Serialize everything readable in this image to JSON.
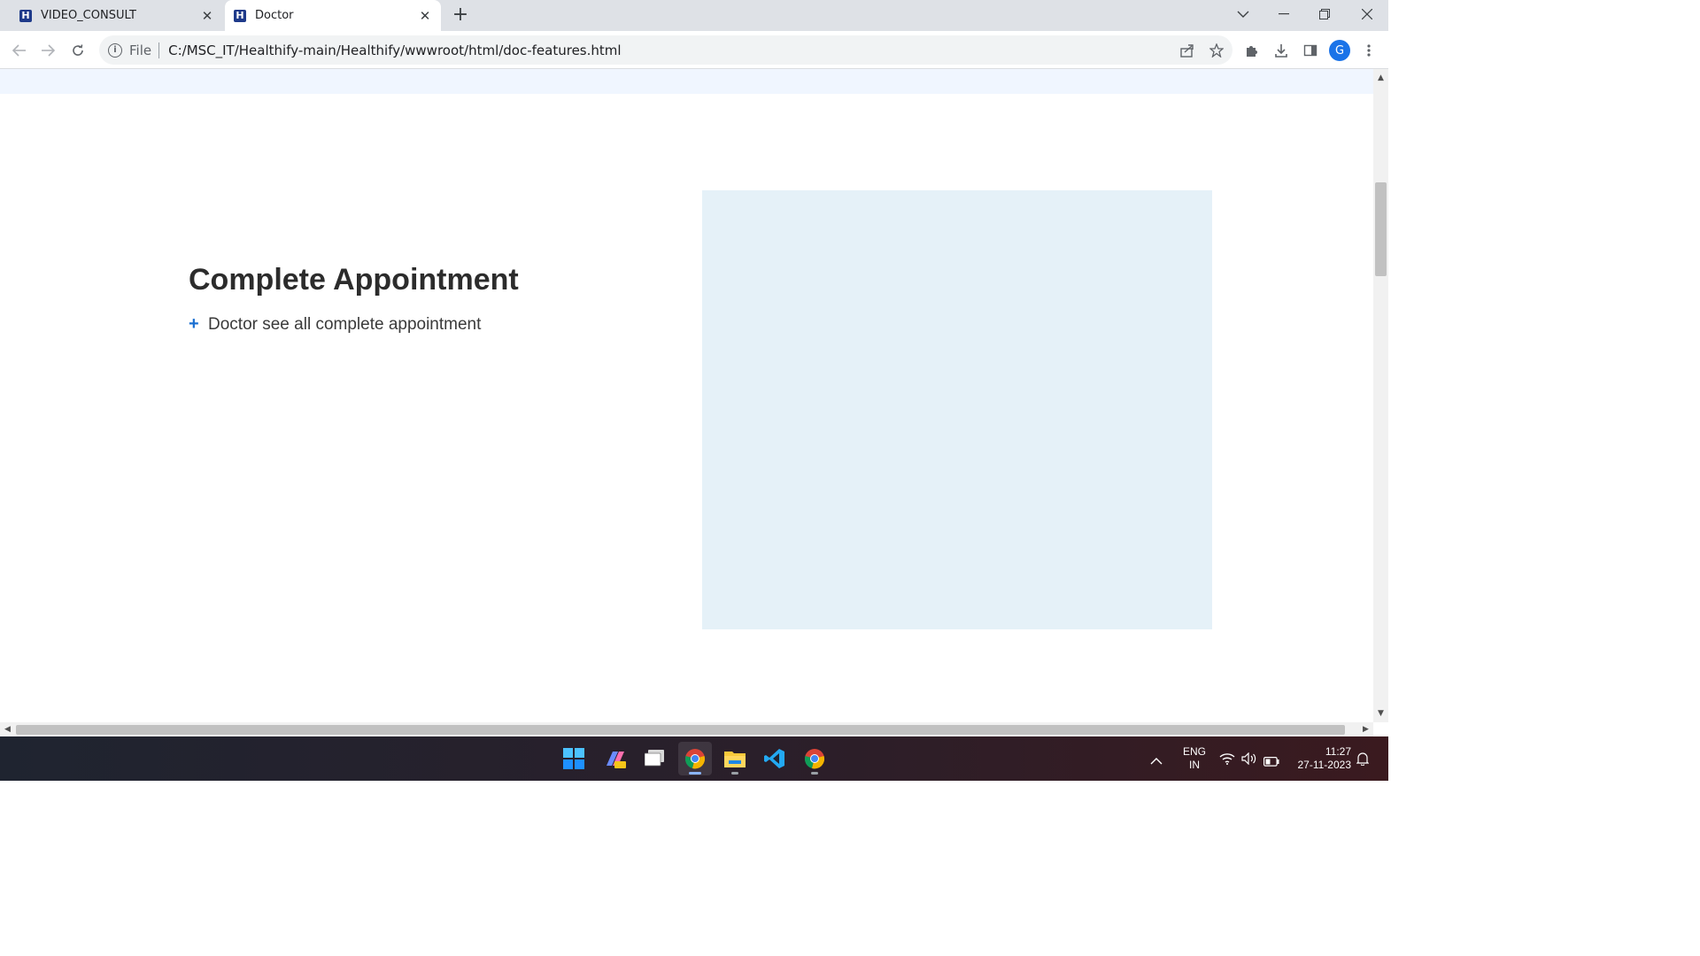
{
  "browser": {
    "tabs": [
      {
        "title": "VIDEO_CONSULT",
        "favicon": "H"
      },
      {
        "title": "Doctor",
        "favicon": "H",
        "active": true
      }
    ],
    "address": {
      "scheme_label": "File",
      "url": "C:/MSC_IT/Healthify-main/Healthify/wwwroot/html/doc-features.html"
    },
    "profile_initial": "G"
  },
  "page": {
    "feature": {
      "title": "Complete Appointment",
      "items": [
        "Doctor see all complete appointment"
      ]
    }
  },
  "taskbar": {
    "language": "ENG",
    "region": "IN",
    "time": "11:27",
    "date": "27-11-2023"
  },
  "colors": {
    "accent": "#1a6fd1",
    "image_placeholder": "#e5f1f8",
    "top_band": "#f0f6ff"
  }
}
